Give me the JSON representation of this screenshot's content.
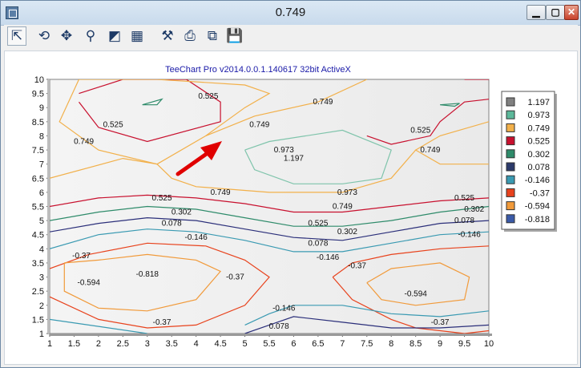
{
  "window": {
    "title": "0.749",
    "buttons": {
      "minimize": "▁",
      "maximize": "▢",
      "close": "✕"
    }
  },
  "toolbar": {
    "items": [
      {
        "name": "select-arrow-icon",
        "glyph": "⇱"
      },
      {
        "name": "rotate-icon",
        "glyph": "⟲"
      },
      {
        "name": "move-icon",
        "glyph": "✥"
      },
      {
        "name": "zoom-icon",
        "glyph": "⚲"
      },
      {
        "name": "depth-icon",
        "glyph": "◩"
      },
      {
        "name": "3d-icon",
        "glyph": "▦"
      },
      {
        "name": "edit-chart-icon",
        "glyph": "⚒"
      },
      {
        "name": "print-icon",
        "glyph": "⎙"
      },
      {
        "name": "copy-icon",
        "glyph": "⧉"
      },
      {
        "name": "save-icon",
        "glyph": "💾"
      }
    ]
  },
  "chart_data": {
    "type": "contour",
    "title": "TeeChart Pro v2014.0.0.1.140617 32bit ActiveX",
    "xlabel": "",
    "ylabel": "",
    "xlim": [
      1,
      10
    ],
    "ylim": [
      1,
      10
    ],
    "x_ticks": [
      "1",
      "1.5",
      "2",
      "2.5",
      "3",
      "3.5",
      "4",
      "4.5",
      "5",
      "5.5",
      "6",
      "6.5",
      "7",
      "7.5",
      "8",
      "8.5",
      "9",
      "9.5",
      "10"
    ],
    "y_ticks": [
      "1",
      "1.5",
      "2",
      "2.5",
      "3",
      "3.5",
      "4",
      "4.5",
      "5",
      "5.5",
      "6",
      "6.5",
      "7",
      "7.5",
      "8",
      "8.5",
      "9",
      "9.5",
      "10"
    ],
    "legend_position": "right",
    "levels": [
      {
        "label": "1.197",
        "value": 1.197,
        "color": "#5aa28b",
        "swatch": "#808080"
      },
      {
        "label": "0.973",
        "value": 0.973,
        "color": "#7fc4ab",
        "swatch": "#5cb89a"
      },
      {
        "label": "0.749",
        "value": 0.749,
        "color": "#f2b04a",
        "swatch": "#f2b04a"
      },
      {
        "label": "0.525",
        "value": 0.525,
        "color": "#c8102e",
        "swatch": "#c8102e"
      },
      {
        "label": "0.302",
        "value": 0.302,
        "color": "#2e8b6a",
        "swatch": "#2e8b6a"
      },
      {
        "label": "0.078",
        "value": 0.078,
        "color": "#2b2f7a",
        "swatch": "#2b3a6a"
      },
      {
        "label": "-0.146",
        "value": -0.146,
        "color": "#3a9ab2",
        "swatch": "#3a9ab2"
      },
      {
        "label": "-0.37",
        "value": -0.37,
        "color": "#e8421c",
        "swatch": "#e8421c"
      },
      {
        "label": "-0.594",
        "value": -0.594,
        "color": "#f19a3a",
        "swatch": "#f19a3a"
      },
      {
        "label": "-0.818",
        "value": -0.818,
        "color": "#3a5aa8",
        "swatch": "#3a5aa8"
      }
    ],
    "contour_lines": [
      {
        "level": "0.525",
        "points": [
          [
            1.6,
            9.5
          ],
          [
            2.5,
            10
          ],
          [
            3.8,
            10
          ],
          [
            4.5,
            9.2
          ],
          [
            4.5,
            8.5
          ],
          [
            3.0,
            7.8
          ],
          [
            2.0,
            8.3
          ],
          [
            1.6,
            9.2
          ]
        ]
      },
      {
        "level": "0.525",
        "points": [
          [
            9.5,
            10
          ],
          [
            10,
            10
          ]
        ],
        "extra": [
          [
            7.5,
            8.0
          ],
          [
            8.0,
            7.7
          ],
          [
            8.8,
            8.0
          ],
          [
            9.0,
            8.5
          ],
          [
            9.5,
            9.2
          ],
          [
            10,
            9.3
          ]
        ]
      },
      {
        "level": "0.749",
        "points": [
          [
            1.6,
            10
          ],
          [
            3.2,
            10
          ],
          [
            5.0,
            9.8
          ],
          [
            5.5,
            9.5
          ],
          [
            5.0,
            9.0
          ],
          [
            4.2,
            8.0
          ],
          [
            3.2,
            7.0
          ],
          [
            2.0,
            7.5
          ],
          [
            1.2,
            8.5
          ],
          [
            1.6,
            10
          ]
        ]
      },
      {
        "level": "0.749",
        "points": [
          [
            4.2,
            8.0
          ],
          [
            5.2,
            8.7
          ],
          [
            6.5,
            9.2
          ],
          [
            7.5,
            10
          ]
        ]
      },
      {
        "level": "0.749",
        "points": [
          [
            10,
            8.5
          ],
          [
            9.0,
            8.0
          ],
          [
            8.5,
            7.5
          ],
          [
            9.0,
            7.0
          ],
          [
            10,
            7.0
          ]
        ]
      },
      {
        "level": "0.749",
        "points": [
          [
            1.0,
            6.5
          ],
          [
            2.5,
            7.2
          ],
          [
            3.2,
            7.0
          ],
          [
            3.5,
            6.5
          ],
          [
            4.0,
            6.2
          ],
          [
            5.5,
            6.0
          ],
          [
            7.0,
            6.0
          ],
          [
            8.0,
            6.5
          ],
          [
            8.5,
            7.5
          ]
        ]
      },
      {
        "level": "0.973",
        "points": [
          [
            5.0,
            7.5
          ],
          [
            5.5,
            7.8
          ],
          [
            7.0,
            8.2
          ],
          [
            8.0,
            7.5
          ],
          [
            7.8,
            6.5
          ],
          [
            7.0,
            6.3
          ],
          [
            6.0,
            6.3
          ],
          [
            5.2,
            6.8
          ],
          [
            5.0,
            7.5
          ]
        ]
      },
      {
        "level": "0.525",
        "points": [
          [
            1.0,
            5.5
          ],
          [
            2.0,
            5.8
          ],
          [
            3.0,
            5.9
          ],
          [
            4.0,
            5.8
          ],
          [
            5.0,
            5.6
          ],
          [
            6.0,
            5.3
          ],
          [
            7.0,
            5.3
          ],
          [
            8.0,
            5.5
          ],
          [
            9.0,
            5.7
          ],
          [
            10,
            5.8
          ]
        ]
      },
      {
        "level": "0.302",
        "points": [
          [
            1.0,
            5.0
          ],
          [
            2.0,
            5.3
          ],
          [
            3.0,
            5.5
          ],
          [
            4.0,
            5.4
          ],
          [
            5.0,
            5.1
          ],
          [
            6.0,
            4.8
          ],
          [
            7.0,
            4.8
          ],
          [
            8.0,
            5.0
          ],
          [
            9.0,
            5.3
          ],
          [
            10,
            5.5
          ]
        ]
      },
      {
        "level": "0.078",
        "points": [
          [
            1.0,
            4.6
          ],
          [
            2.0,
            4.9
          ],
          [
            3.0,
            5.1
          ],
          [
            4.0,
            5.0
          ],
          [
            5.0,
            4.7
          ],
          [
            6.0,
            4.4
          ],
          [
            7.0,
            4.3
          ],
          [
            8.0,
            4.6
          ],
          [
            9.0,
            4.9
          ],
          [
            10,
            5.0
          ]
        ]
      },
      {
        "level": "-0.146",
        "points": [
          [
            1.0,
            4.0
          ],
          [
            2.0,
            4.5
          ],
          [
            3.0,
            4.7
          ],
          [
            4.0,
            4.6
          ],
          [
            5.0,
            4.3
          ],
          [
            6.0,
            3.9
          ],
          [
            7.0,
            3.9
          ],
          [
            8.0,
            4.2
          ],
          [
            9.0,
            4.5
          ],
          [
            10,
            4.6
          ]
        ]
      },
      {
        "level": "-0.37",
        "points": [
          [
            1.0,
            3.3
          ],
          [
            1.8,
            3.8
          ],
          [
            3.0,
            4.2
          ],
          [
            4.2,
            4.1
          ],
          [
            5.0,
            3.6
          ],
          [
            5.5,
            3.0
          ],
          [
            5.0,
            2.0
          ],
          [
            4.0,
            1.3
          ],
          [
            3.0,
            1.2
          ],
          [
            2.0,
            1.5
          ],
          [
            1.0,
            2.3
          ]
        ]
      },
      {
        "level": "-0.594",
        "points": [
          [
            1.3,
            3.5
          ],
          [
            2.0,
            3.6
          ],
          [
            3.0,
            3.8
          ],
          [
            4.0,
            3.6
          ],
          [
            4.5,
            3.2
          ],
          [
            4.0,
            2.2
          ],
          [
            3.0,
            1.8
          ],
          [
            2.0,
            1.9
          ],
          [
            1.3,
            2.5
          ],
          [
            1.3,
            3.5
          ]
        ]
      },
      {
        "level": "-0.37",
        "points": [
          [
            6.8,
            3.0
          ],
          [
            7.2,
            3.5
          ],
          [
            8.0,
            3.8
          ],
          [
            9.0,
            4.0
          ],
          [
            10,
            4.1
          ]
        ]
      },
      {
        "level": "-0.37",
        "points": [
          [
            6.8,
            3.0
          ],
          [
            7.2,
            2.2
          ],
          [
            8.0,
            1.5
          ],
          [
            8.5,
            1.2
          ],
          [
            9.5,
            1.0
          ],
          [
            10,
            1.1
          ]
        ]
      },
      {
        "level": "-0.594",
        "points": [
          [
            7.5,
            2.8
          ],
          [
            8.0,
            3.3
          ],
          [
            9.0,
            3.5
          ],
          [
            9.6,
            3.0
          ],
          [
            9.5,
            2.2
          ],
          [
            8.5,
            2.0
          ],
          [
            7.8,
            2.2
          ],
          [
            7.5,
            2.8
          ]
        ]
      },
      {
        "level": "-0.146",
        "points": [
          [
            1.0,
            1.5
          ],
          [
            1.8,
            1.3
          ],
          [
            3.0,
            1.0
          ]
        ]
      },
      {
        "level": "-0.146",
        "points": [
          [
            5.0,
            1.3
          ],
          [
            5.5,
            1.7
          ],
          [
            6.0,
            2.0
          ],
          [
            7.0,
            2.0
          ],
          [
            8.0,
            1.7
          ],
          [
            9.0,
            1.6
          ],
          [
            10,
            1.8
          ]
        ]
      },
      {
        "level": "0.078",
        "points": [
          [
            5.0,
            1.0
          ],
          [
            5.5,
            1.3
          ],
          [
            6.0,
            1.6
          ],
          [
            7.0,
            1.4
          ],
          [
            8.0,
            1.2
          ],
          [
            9.0,
            1.2
          ],
          [
            10,
            1.3
          ]
        ]
      }
    ],
    "labels": [
      {
        "text": "0.525",
        "x": 4.25,
        "y": 9.4
      },
      {
        "text": "0.749",
        "x": 6.6,
        "y": 9.2
      },
      {
        "text": "0.525",
        "x": 2.3,
        "y": 8.4
      },
      {
        "text": "0.749",
        "x": 5.3,
        "y": 8.4
      },
      {
        "text": "0.525",
        "x": 8.6,
        "y": 8.2
      },
      {
        "text": "0.749",
        "x": 1.7,
        "y": 7.8
      },
      {
        "text": "0.973",
        "x": 5.8,
        "y": 7.5
      },
      {
        "text": "0.749",
        "x": 8.8,
        "y": 7.5
      },
      {
        "text": "1.197",
        "x": 6.0,
        "y": 7.2
      },
      {
        "text": "0.749",
        "x": 4.5,
        "y": 6.0
      },
      {
        "text": "0.973",
        "x": 7.1,
        "y": 6.0
      },
      {
        "text": "0.525",
        "x": 3.3,
        "y": 5.8
      },
      {
        "text": "0.749",
        "x": 7.0,
        "y": 5.5
      },
      {
        "text": "0.525",
        "x": 9.5,
        "y": 5.8
      },
      {
        "text": "0.302",
        "x": 3.7,
        "y": 5.3
      },
      {
        "text": "0.302",
        "x": 9.7,
        "y": 5.4
      },
      {
        "text": "0.525",
        "x": 6.5,
        "y": 4.9
      },
      {
        "text": "0.078",
        "x": 3.5,
        "y": 4.9
      },
      {
        "text": "0.078",
        "x": 9.5,
        "y": 5.0
      },
      {
        "text": "0.302",
        "x": 7.1,
        "y": 4.6
      },
      {
        "text": "-0.146",
        "x": 4.0,
        "y": 4.4
      },
      {
        "text": "-0.146",
        "x": 9.6,
        "y": 4.5
      },
      {
        "text": "0.078",
        "x": 6.5,
        "y": 4.2
      },
      {
        "text": "-0.37",
        "x": 1.65,
        "y": 3.75
      },
      {
        "text": "-0.146",
        "x": 6.7,
        "y": 3.7
      },
      {
        "text": "-0.37",
        "x": 7.3,
        "y": 3.4
      },
      {
        "text": "-0.818",
        "x": 3.0,
        "y": 3.1
      },
      {
        "text": "-0.594",
        "x": 1.8,
        "y": 2.8
      },
      {
        "text": "-0.37",
        "x": 4.8,
        "y": 3.0
      },
      {
        "text": "-0.594",
        "x": 8.5,
        "y": 2.4
      },
      {
        "text": "-0.146",
        "x": 5.8,
        "y": 1.9
      },
      {
        "text": "-0.37",
        "x": 3.3,
        "y": 1.4
      },
      {
        "text": "-0.37",
        "x": 9.0,
        "y": 1.4
      },
      {
        "text": "0.078",
        "x": 5.7,
        "y": 1.25
      }
    ]
  }
}
